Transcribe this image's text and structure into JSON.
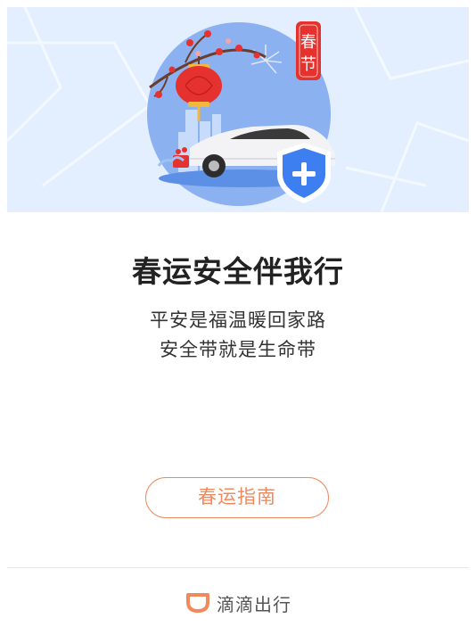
{
  "banner": {
    "badge_text": "春节",
    "colors": {
      "background": "#e3efff",
      "circle": "#7da6ee",
      "car": "#f3f3f5",
      "shield": "#3d7ff0",
      "lantern": "#e5322f",
      "badge": "#e5322f"
    }
  },
  "content": {
    "title": "春运安全伴我行",
    "line1": "平安是福温暖回家路",
    "line2": "安全带就是生命带"
  },
  "guide_button": {
    "label": "春运指南",
    "color": "#f08a5d"
  },
  "footer": {
    "brand": "滴滴出行",
    "logo_color": "#f08a5d"
  }
}
